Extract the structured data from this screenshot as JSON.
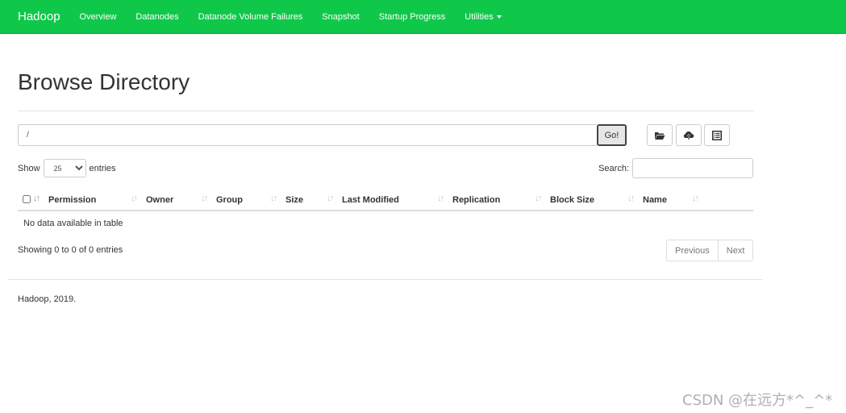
{
  "navbar": {
    "brand": "Hadoop",
    "items": [
      "Overview",
      "Datanodes",
      "Datanode Volume Failures",
      "Snapshot",
      "Startup Progress",
      "Utilities"
    ],
    "color": "#0fc84a"
  },
  "page": {
    "title": "Browse Directory"
  },
  "path_bar": {
    "value": "/",
    "go_label": "Go!",
    "icons": [
      "folder-open-icon",
      "cloud-upload-icon",
      "list-alt-icon"
    ]
  },
  "length": {
    "show_label": "Show",
    "selected": "25",
    "entries_label": "entries"
  },
  "search": {
    "label": "Search:",
    "value": ""
  },
  "table": {
    "columns": [
      "Permission",
      "Owner",
      "Group",
      "Size",
      "Last Modified",
      "Replication",
      "Block Size",
      "Name"
    ],
    "empty_message": "No data available in table"
  },
  "info": {
    "text": "Showing 0 to 0 of 0 entries"
  },
  "pagination": {
    "previous": "Previous",
    "next": "Next"
  },
  "footer": {
    "text": "Hadoop, 2019."
  },
  "watermark": {
    "text": "CSDN @在远方*^_^*"
  }
}
